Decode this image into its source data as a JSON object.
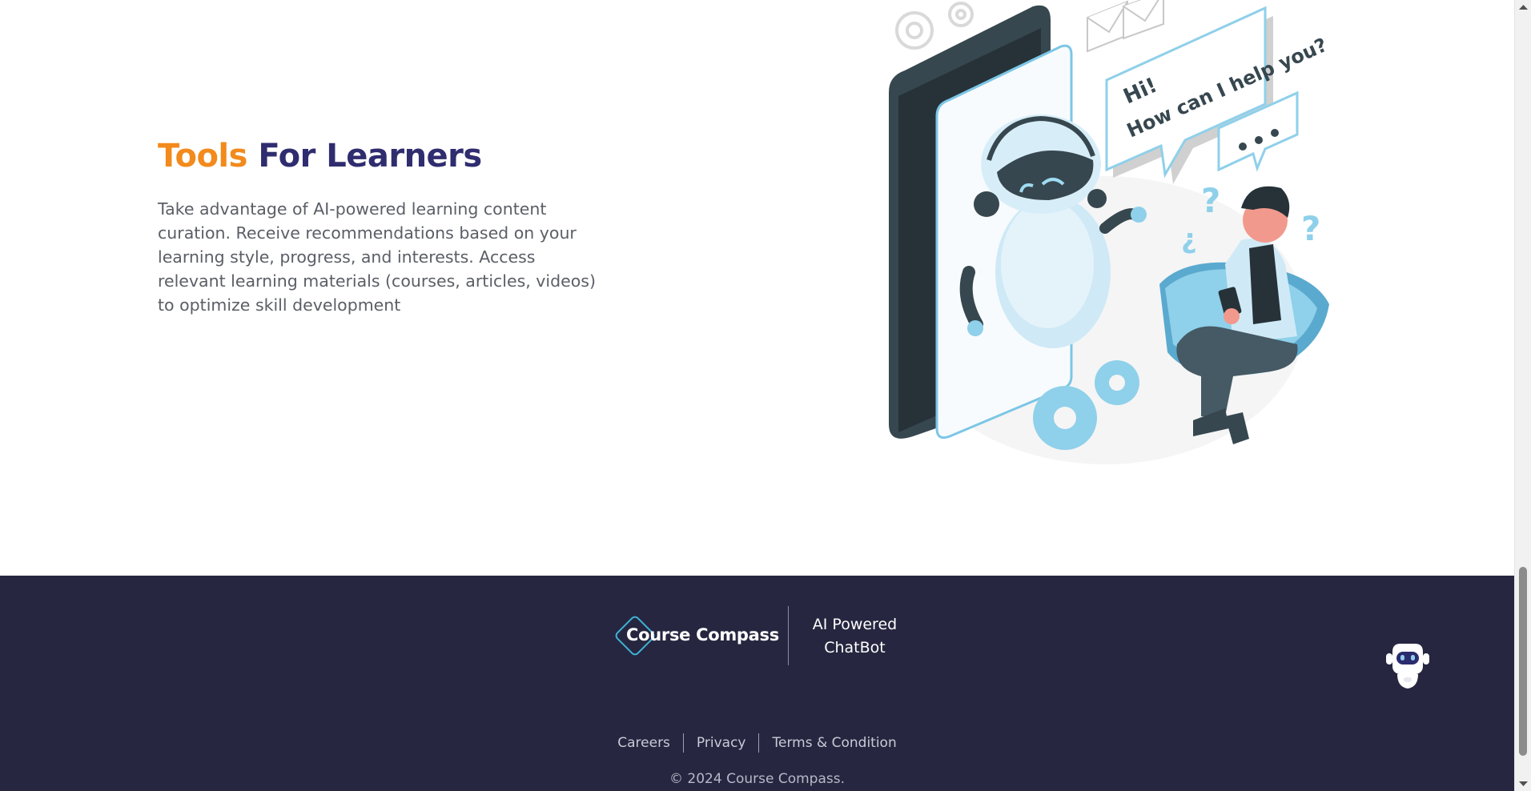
{
  "tools": {
    "title_highlight": "Tools",
    "title_rest": "For Learners",
    "description": "Take advantage of AI-powered learning content curation. Receive recommendations based on your learning style, progress, and interests. Access relevant learning materials (courses, articles, videos) to optimize skill development",
    "illustration": {
      "speech_line1": "Hi!",
      "speech_line2": "How can I help you?",
      "icon": "robot-chat-illustration"
    }
  },
  "footer": {
    "logo_text": "Course Compass",
    "chatbot_label_line1": "AI Powered",
    "chatbot_label_line2": "ChatBot",
    "links": [
      "Careers",
      "Privacy",
      "Terms & Condition"
    ],
    "copyright": "© 2024 Course Compass.",
    "bot_icon": "robot-icon"
  },
  "colors": {
    "accent_orange": "#f28a1c",
    "title_navy": "#2f2d6f",
    "footer_bg": "#262640",
    "logo_cyan": "#3fb3d6",
    "illustration_blue": "#8fd0ea"
  }
}
